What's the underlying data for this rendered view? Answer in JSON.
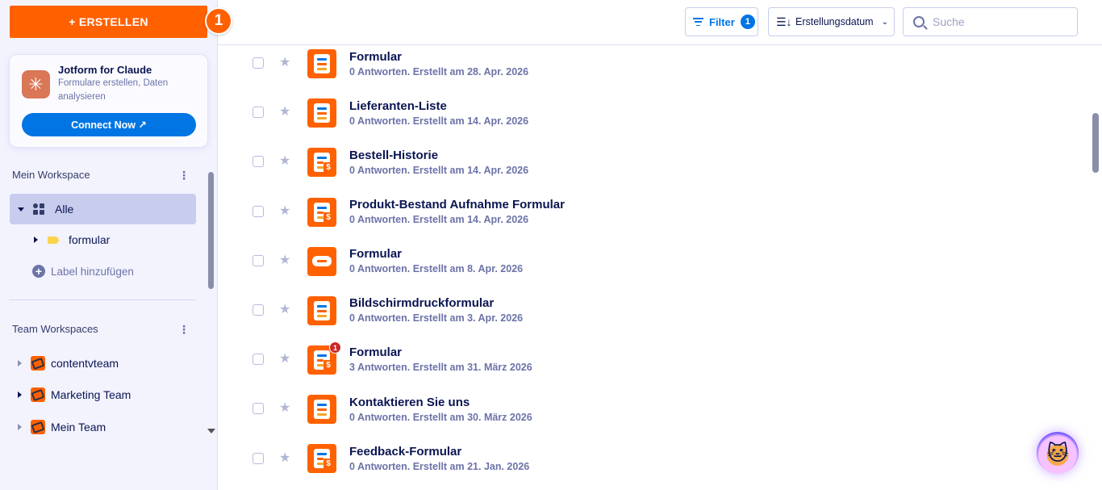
{
  "sidebar": {
    "create_label": "+ ERSTELLEN",
    "step_number": "1",
    "promo": {
      "icon": "asterisk-icon",
      "title": "Jotform for Claude",
      "subtitle": "Formulare erstellen, Daten analysieren",
      "button": "Connect Now ↗"
    },
    "my_workspace": {
      "heading": "Mein Workspace",
      "items": [
        {
          "label": "Alle",
          "active": true
        },
        {
          "label": "formular"
        }
      ],
      "add_label": "Label hinzufügen"
    },
    "team_workspaces": {
      "heading": "Team Workspaces",
      "items": [
        {
          "label": "contentvteam"
        },
        {
          "label": "Marketing Team"
        },
        {
          "label": "Mein Team"
        }
      ]
    }
  },
  "toolbar": {
    "filter_label": "Filter",
    "filter_count": "1",
    "sort_label": "Erstellungsdatum",
    "search_placeholder": "Suche"
  },
  "forms": [
    {
      "title": "Formular",
      "meta": "0 Antworten. Erstellt am 28. Apr. 2026",
      "icon": "form-icon"
    },
    {
      "title": "Lieferanten-Liste",
      "meta": "0 Antworten. Erstellt am 14. Apr. 2026",
      "icon": "form-icon"
    },
    {
      "title": "Bestell-Historie",
      "meta": "0 Antworten. Erstellt am 14. Apr. 2026",
      "icon": "payment-form-icon"
    },
    {
      "title": "Produkt-Bestand Aufnahme Formular",
      "meta": "0 Antworten. Erstellt am 14. Apr. 2026",
      "icon": "payment-form-icon"
    },
    {
      "title": "Formular",
      "meta": "0 Antworten. Erstellt am 8. Apr. 2026",
      "icon": "card-form-icon"
    },
    {
      "title": "Bildschirmdruckformular",
      "meta": "0 Antworten. Erstellt am 3. Apr. 2026",
      "icon": "form-icon"
    },
    {
      "title": "Formular",
      "meta": "3 Antworten. Erstellt am 31. März 2026",
      "icon": "payment-form-icon",
      "badge": "1"
    },
    {
      "title": "Kontaktieren Sie uns",
      "meta": "0 Antworten. Erstellt am 30. März 2026",
      "icon": "form-icon"
    },
    {
      "title": "Feedback-Formular",
      "meta": "0 Antworten. Erstellt am 21. Jan. 2026",
      "icon": "payment-form-icon"
    }
  ],
  "colors": {
    "brand_orange": "#ff6100",
    "brand_blue": "#0075e3",
    "navy": "#0a1551",
    "muted": "#6c73a8"
  }
}
